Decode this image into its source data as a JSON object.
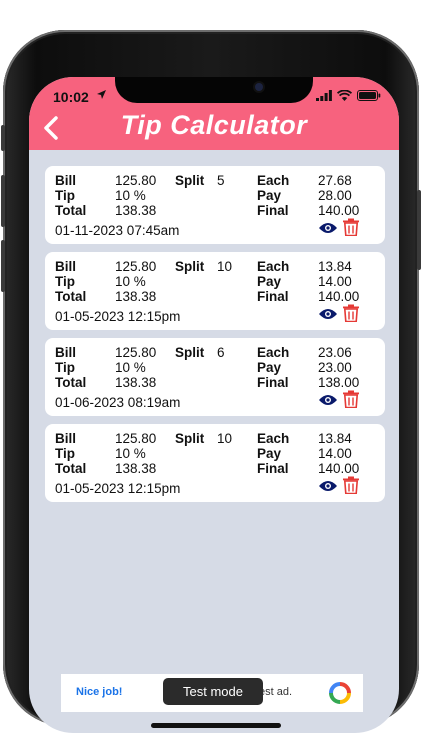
{
  "status_bar": {
    "time": "10:02"
  },
  "header": {
    "title": "Tip Calculator"
  },
  "labels": {
    "bill": "Bill",
    "tip": "Tip",
    "total": "Total",
    "split": "Split",
    "each": "Each",
    "pay": "Pay",
    "final": "Final"
  },
  "records": [
    {
      "bill": "125.80",
      "split": "5",
      "tip": "10 %",
      "total": "138.38",
      "each": "27.68",
      "pay": "28.00",
      "final": "140.00",
      "datetime": "01-11-2023 07:45am"
    },
    {
      "bill": "125.80",
      "split": "10",
      "tip": "10 %",
      "total": "138.38",
      "each": "13.84",
      "pay": "14.00",
      "final": "140.00",
      "datetime": "01-05-2023 12:15pm"
    },
    {
      "bill": "125.80",
      "split": "6",
      "tip": "10 %",
      "total": "138.38",
      "each": "23.06",
      "pay": "23.00",
      "final": "138.00",
      "datetime": "01-06-2023 08:19am"
    },
    {
      "bill": "125.80",
      "split": "10",
      "tip": "10 %",
      "total": "138.38",
      "each": "13.84",
      "pay": "14.00",
      "final": "140.00",
      "datetime": "01-05-2023 12:15pm"
    }
  ],
  "ad": {
    "left_text": "Nice job!",
    "right_text": "est ad."
  },
  "toast": {
    "text": "Test mode"
  },
  "colors": {
    "header": "#f7627e",
    "background": "#d6dbe6",
    "eye": "#0a1a6b",
    "trash": "#e53935",
    "ad_link": "#1a73e8"
  },
  "icons": [
    "back-arrow-icon",
    "location-arrow-icon",
    "signal-icon",
    "wifi-icon",
    "battery-icon",
    "eye-icon",
    "trash-icon",
    "ad-logo-icon"
  ]
}
